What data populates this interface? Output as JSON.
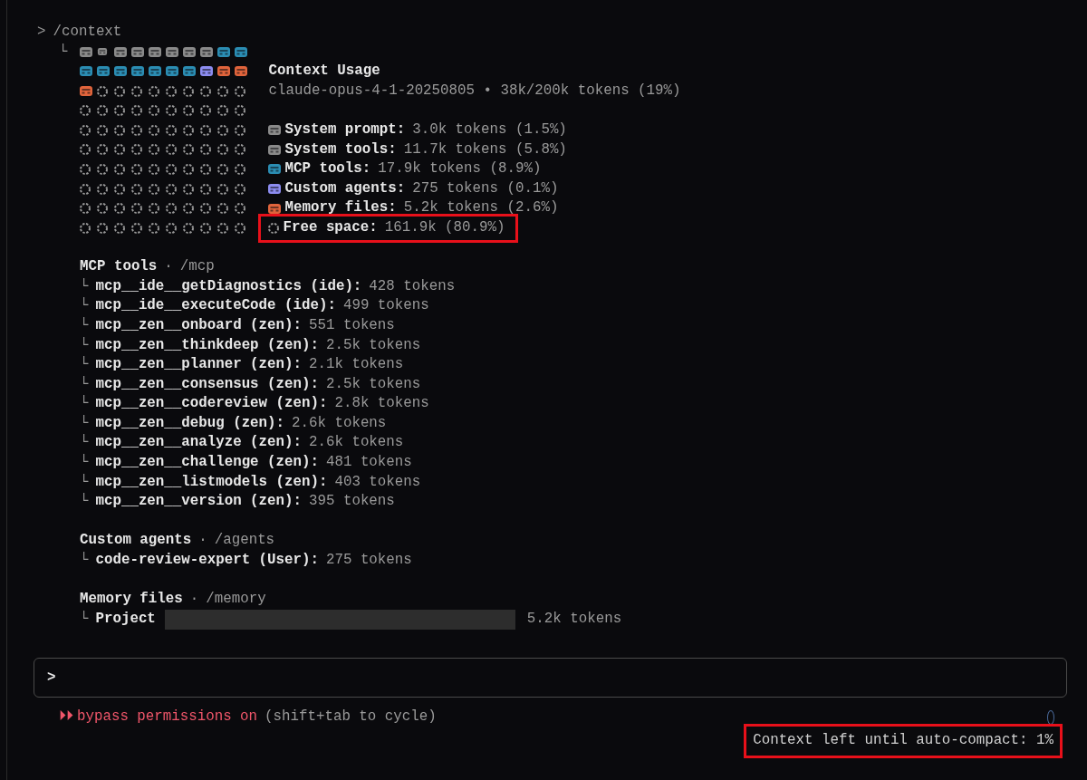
{
  "command": {
    "prompt": ">",
    "text": "/context"
  },
  "usage": {
    "branch": "└",
    "grid": [
      {
        "cells": [
          {
            "kind": "system"
          },
          {
            "kind": "system-small"
          },
          {
            "kind": "system"
          },
          {
            "kind": "system"
          },
          {
            "kind": "system"
          },
          {
            "kind": "system"
          },
          {
            "kind": "system"
          },
          {
            "kind": "system"
          },
          {
            "kind": "mcp"
          },
          {
            "kind": "mcp"
          }
        ]
      },
      {
        "cells": [
          {
            "kind": "mcp"
          },
          {
            "kind": "mcp"
          },
          {
            "kind": "mcp"
          },
          {
            "kind": "mcp"
          },
          {
            "kind": "mcp"
          },
          {
            "kind": "mcp"
          },
          {
            "kind": "mcp"
          },
          {
            "kind": "agent"
          },
          {
            "kind": "memory"
          },
          {
            "kind": "memory"
          }
        ]
      },
      {
        "cells": [
          {
            "kind": "memory"
          },
          {
            "kind": "free"
          },
          {
            "kind": "free"
          },
          {
            "kind": "free"
          },
          {
            "kind": "free"
          },
          {
            "kind": "free"
          },
          {
            "kind": "free"
          },
          {
            "kind": "free"
          },
          {
            "kind": "free"
          },
          {
            "kind": "free"
          }
        ]
      },
      {
        "cells": [
          {
            "kind": "free"
          },
          {
            "kind": "free"
          },
          {
            "kind": "free"
          },
          {
            "kind": "free"
          },
          {
            "kind": "free"
          },
          {
            "kind": "free"
          },
          {
            "kind": "free"
          },
          {
            "kind": "free"
          },
          {
            "kind": "free"
          },
          {
            "kind": "free"
          }
        ]
      },
      {
        "cells": [
          {
            "kind": "free"
          },
          {
            "kind": "free"
          },
          {
            "kind": "free"
          },
          {
            "kind": "free"
          },
          {
            "kind": "free"
          },
          {
            "kind": "free"
          },
          {
            "kind": "free"
          },
          {
            "kind": "free"
          },
          {
            "kind": "free"
          },
          {
            "kind": "free"
          }
        ]
      },
      {
        "cells": [
          {
            "kind": "free"
          },
          {
            "kind": "free"
          },
          {
            "kind": "free"
          },
          {
            "kind": "free"
          },
          {
            "kind": "free"
          },
          {
            "kind": "free"
          },
          {
            "kind": "free"
          },
          {
            "kind": "free"
          },
          {
            "kind": "free"
          },
          {
            "kind": "free"
          }
        ]
      },
      {
        "cells": [
          {
            "kind": "free"
          },
          {
            "kind": "free"
          },
          {
            "kind": "free"
          },
          {
            "kind": "free"
          },
          {
            "kind": "free"
          },
          {
            "kind": "free"
          },
          {
            "kind": "free"
          },
          {
            "kind": "free"
          },
          {
            "kind": "free"
          },
          {
            "kind": "free"
          }
        ]
      },
      {
        "cells": [
          {
            "kind": "free"
          },
          {
            "kind": "free"
          },
          {
            "kind": "free"
          },
          {
            "kind": "free"
          },
          {
            "kind": "free"
          },
          {
            "kind": "free"
          },
          {
            "kind": "free"
          },
          {
            "kind": "free"
          },
          {
            "kind": "free"
          },
          {
            "kind": "free"
          }
        ]
      },
      {
        "cells": [
          {
            "kind": "free"
          },
          {
            "kind": "free"
          },
          {
            "kind": "free"
          },
          {
            "kind": "free"
          },
          {
            "kind": "free"
          },
          {
            "kind": "free"
          },
          {
            "kind": "free"
          },
          {
            "kind": "free"
          },
          {
            "kind": "free"
          },
          {
            "kind": "free"
          }
        ]
      },
      {
        "cells": [
          {
            "kind": "free"
          },
          {
            "kind": "free"
          },
          {
            "kind": "free"
          },
          {
            "kind": "free"
          },
          {
            "kind": "free"
          },
          {
            "kind": "free"
          },
          {
            "kind": "free"
          },
          {
            "kind": "free"
          },
          {
            "kind": "free"
          },
          {
            "kind": "free"
          }
        ]
      }
    ],
    "title": "Context Usage",
    "model_line": "claude-opus-4-1-20250805 • 38k/200k tokens (19%)",
    "legend": [
      {
        "kind": "system",
        "color": "#8a8a8a",
        "label": "System prompt:",
        "value": "3.0k tokens (1.5%)",
        "highlighted": false
      },
      {
        "kind": "system",
        "color": "#8a8a8a",
        "label": "System tools:",
        "value": "11.7k tokens (5.8%)",
        "highlighted": false
      },
      {
        "kind": "mcp",
        "color": "#2b8db3",
        "label": "MCP tools:",
        "value": "17.9k tokens (8.9%)",
        "highlighted": false
      },
      {
        "kind": "agent",
        "color": "#8c8cf0",
        "label": "Custom agents:",
        "value": "275 tokens (0.1%)",
        "highlighted": false
      },
      {
        "kind": "memory",
        "color": "#e0643c",
        "label": "Memory files:",
        "value": "5.2k tokens (2.6%)",
        "highlighted": false
      },
      {
        "kind": "free",
        "color": "#9a9a9a",
        "label": "Free space:",
        "value": "161.9k (80.9%)",
        "highlighted": true
      }
    ]
  },
  "sections": [
    {
      "title": "MCP tools",
      "separator": "·",
      "command": "/mcp",
      "items": [
        {
          "branch": "└",
          "name": "mcp__ide__getDiagnostics (ide):",
          "value": "428 tokens"
        },
        {
          "branch": "└",
          "name": "mcp__ide__executeCode (ide):",
          "value": "499 tokens"
        },
        {
          "branch": "└",
          "name": "mcp__zen__onboard (zen):",
          "value": "551 tokens"
        },
        {
          "branch": "└",
          "name": "mcp__zen__thinkdeep (zen):",
          "value": "2.5k tokens"
        },
        {
          "branch": "└",
          "name": "mcp__zen__planner (zen):",
          "value": "2.1k tokens"
        },
        {
          "branch": "└",
          "name": "mcp__zen__consensus (zen):",
          "value": "2.5k tokens"
        },
        {
          "branch": "└",
          "name": "mcp__zen__codereview (zen):",
          "value": "2.8k tokens"
        },
        {
          "branch": "└",
          "name": "mcp__zen__debug (zen):",
          "value": "2.6k tokens"
        },
        {
          "branch": "└",
          "name": "mcp__zen__analyze (zen):",
          "value": "2.6k tokens"
        },
        {
          "branch": "└",
          "name": "mcp__zen__challenge (zen):",
          "value": "481 tokens"
        },
        {
          "branch": "└",
          "name": "mcp__zen__listmodels (zen):",
          "value": "403 tokens"
        },
        {
          "branch": "└",
          "name": "mcp__zen__version (zen):",
          "value": "395 tokens"
        }
      ]
    },
    {
      "title": "Custom agents",
      "separator": "·",
      "command": "/agents",
      "items": [
        {
          "branch": "└",
          "name": "code-review-expert (User):",
          "value": "275 tokens"
        }
      ]
    },
    {
      "title": "Memory files",
      "separator": "·",
      "command": "/memory",
      "items": [
        {
          "branch": "└",
          "name": "Project",
          "redacted": true,
          "value": "5.2k tokens"
        }
      ]
    }
  ],
  "input": {
    "prompt": ">"
  },
  "mode": {
    "icon": "⏵⏵",
    "label": "bypass permissions on",
    "hint": "(shift+tab to cycle)"
  },
  "status": {
    "text": "Context left until auto-compact: 1%",
    "highlighted": true
  }
}
